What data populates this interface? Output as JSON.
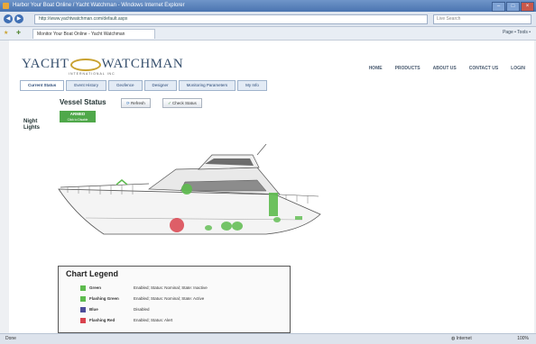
{
  "browser": {
    "title": "Harbor Your Boat Online / Yacht Watchman - Windows Internet Explorer",
    "url": "http://www.yachtwatchman.com/default.aspx",
    "search_placeholder": "Live Search",
    "tab_label": "Monitor Your Boat Online - Yacht Watchman",
    "tools": "Page • Tools •",
    "status_left": "Done",
    "status_zone": "Internet",
    "zoom": "100%"
  },
  "site": {
    "logo_left": "YACHT",
    "logo_right": "WATCHMAN",
    "logo_sub": "INTERNATIONAL INC",
    "topnav": [
      "HOME",
      "PRODUCTS",
      "ABOUT US",
      "CONTACT US",
      "LOGIN"
    ],
    "subnav": [
      "Current Status",
      "Event History",
      "Geofence",
      "Designer",
      "Monitoring Parameters",
      "My Info"
    ],
    "active_subnav": "Current Status"
  },
  "vessel": {
    "heading": "Vessel Status",
    "refresh_label": "Refresh",
    "check_label": "Check Status",
    "armed_label": "ARMED",
    "armed_sub": "Click to Disable",
    "night_lights": "Night Lights"
  },
  "legend": {
    "title": "Chart Legend",
    "items": [
      {
        "name": "Green",
        "desc": "Enabled; Status: Nominal; State: Inactive",
        "color": "#5dbb4e"
      },
      {
        "name": "Flashing Green",
        "desc": "Enabled; Status: Nominal; State: Active",
        "color": "#5dbb4e"
      },
      {
        "name": "Blue",
        "desc": "Disabled",
        "color": "#4d4d9a"
      },
      {
        "name": "Flashing Red",
        "desc": "Enabled; Status: Alert",
        "color": "#d9434e"
      }
    ]
  },
  "colors": {
    "accent": "#4fa84a",
    "brand": "#37506e",
    "alert": "#d9434e"
  }
}
